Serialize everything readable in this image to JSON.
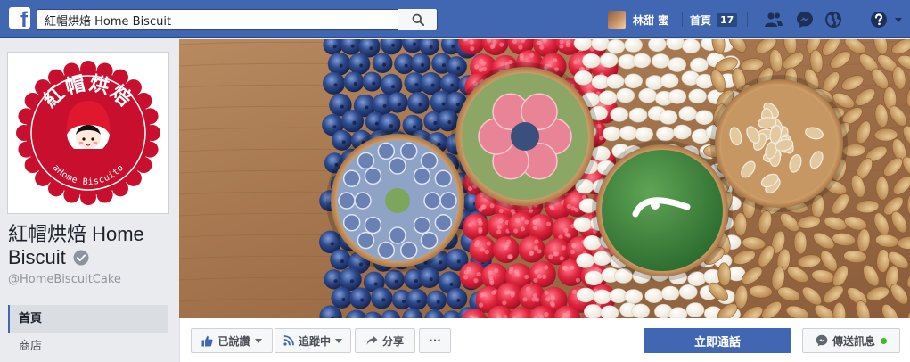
{
  "topbar": {
    "brand_icon": "facebook-logo-icon",
    "search": {
      "value": "紅帽烘焙 Home Biscuit",
      "placeholder": "",
      "icon": "search-icon"
    },
    "profile_name": "林甜 蜜",
    "home_label": "首頁",
    "home_count": "17",
    "icons": [
      "friend-requests-icon",
      "messenger-icon",
      "globe-notifications-icon",
      "help-icon"
    ],
    "accent_color": "#4267b2"
  },
  "page": {
    "name": "紅帽烘焙 Home Biscuit",
    "handle": "@HomeBiscuitCake",
    "verified_icon": "verified-check-icon",
    "logo_text_top": "紅帽烘焙",
    "logo_text_bottom": "aHome Biscuito"
  },
  "left_nav": {
    "items": [
      {
        "label": "首頁",
        "active": true
      },
      {
        "label": "商店",
        "active": false
      }
    ]
  },
  "actions": {
    "liked_label": "已說讚",
    "following_label": "追蹤中",
    "share_label": "分享",
    "more_label": "···",
    "call_label": "立即通話",
    "message_label": "傳送訊息",
    "call_color": "#4267b2",
    "online_color": "#42b72a"
  }
}
